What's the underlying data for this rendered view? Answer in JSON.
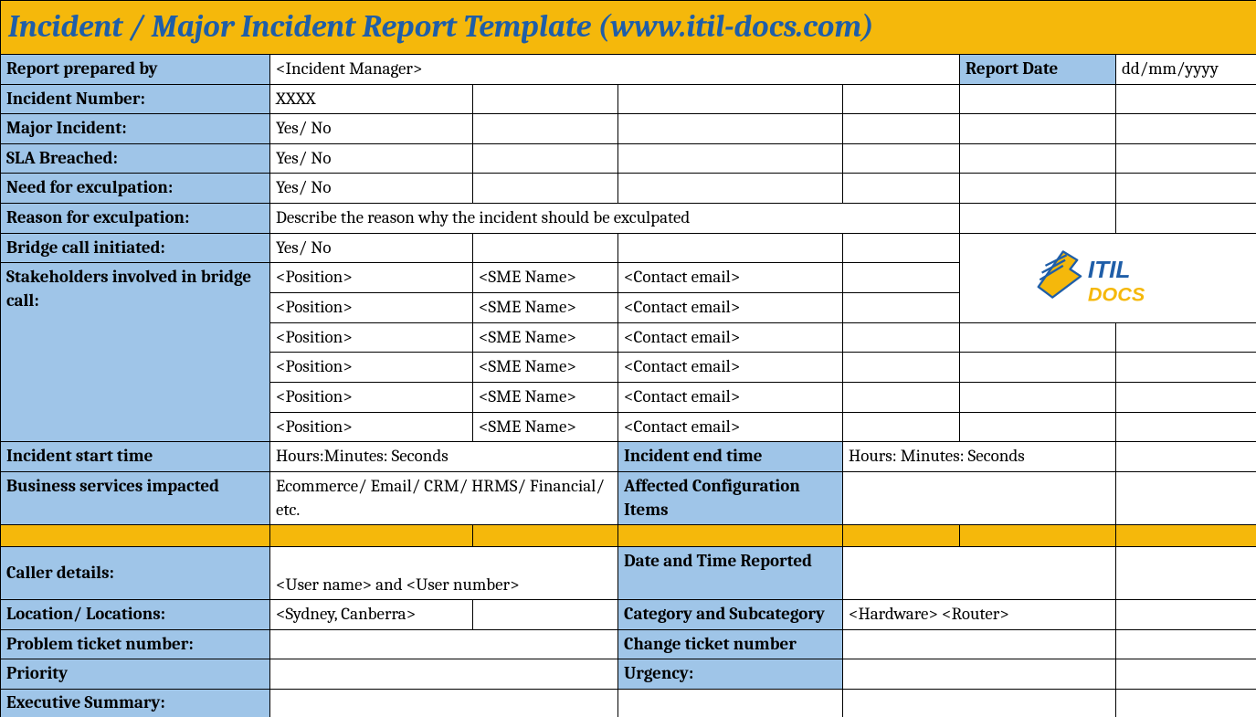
{
  "title": "Incident / Major Incident Report Template   (www.itil-docs.com)",
  "labels": {
    "report_prepared_by": "Report prepared by",
    "report_date": "Report Date",
    "incident_number": "Incident Number:",
    "major_incident": "Major Incident:",
    "sla_breached": "SLA Breached:",
    "need_exculpation": "Need for exculpation:",
    "reason_exculpation": "Reason for exculpation:",
    "bridge_call": "Bridge call initiated:",
    "stakeholders": "Stakeholders involved in bridge call:",
    "incident_start": "Incident start time",
    "incident_end": "Incident end time",
    "biz_services": "Business services impacted",
    "affected_ci": "Affected Configuration Items",
    "caller_details": "Caller details:",
    "date_time_reported": "Date and Time Reported",
    "location": "Location/ Locations:",
    "category": "Category and Subcategory",
    "problem_ticket": "Problem ticket number:",
    "change_ticket": "Change ticket number",
    "priority": "Priority",
    "urgency": "Urgency:",
    "exec_summary": "Executive Summary:"
  },
  "values": {
    "report_prepared_by": "<Incident Manager>",
    "report_date": "dd/mm/yyyy",
    "incident_number": "XXXX",
    "major_incident": "Yes/ No",
    "sla_breached": "Yes/ No",
    "need_exculpation": "Yes/ No",
    "reason_exculpation": "Describe the reason why the incident should be exculpated",
    "bridge_call": "Yes/ No",
    "stakeholders": [
      {
        "position": "<Position>",
        "sme": "<SME Name>",
        "email": "<Contact email>"
      },
      {
        "position": "<Position>",
        "sme": "<SME Name>",
        "email": "<Contact email>"
      },
      {
        "position": "<Position>",
        "sme": "<SME Name>",
        "email": "<Contact email>"
      },
      {
        "position": "<Position>",
        "sme": "<SME Name>",
        "email": "<Contact email>"
      },
      {
        "position": "<Position>",
        "sme": "<SME Name>",
        "email": "<Contact email>"
      },
      {
        "position": "<Position>",
        "sme": "<SME Name>",
        "email": "<Contact email>"
      }
    ],
    "incident_start": "Hours:Minutes: Seconds",
    "incident_end": "Hours: Minutes: Seconds",
    "biz_services": "Ecommerce/ Email/ CRM/ HRMS/ Financial/ etc.",
    "caller_details": "<User name> and <User number>",
    "location": "<Sydney, Canberra>",
    "category": "<Hardware> <Router>"
  },
  "logo": {
    "text_itil": "ITIL",
    "text_docs": "DOCS",
    "color_itil": "#1f5ea8",
    "color_docs": "#f5b80b"
  }
}
